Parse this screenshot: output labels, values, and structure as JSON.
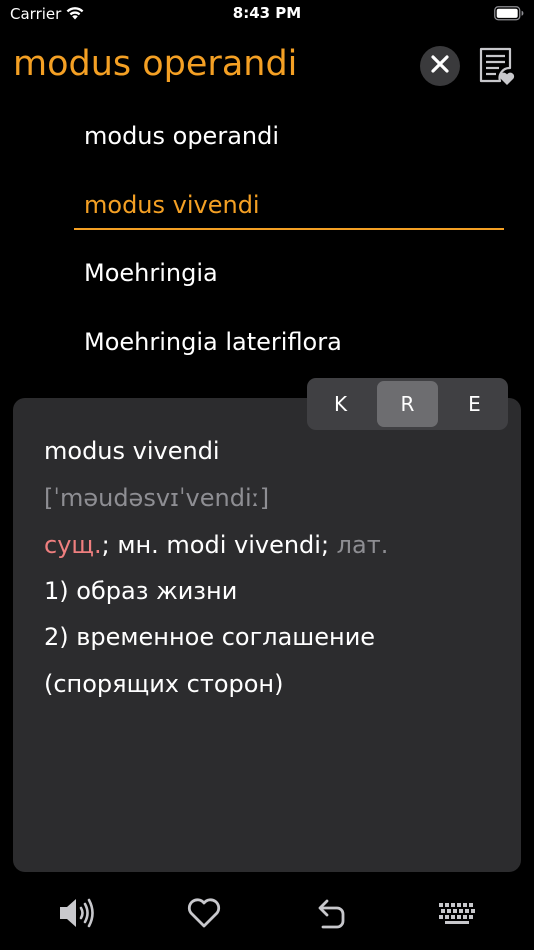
{
  "status_bar": {
    "carrier": "Carrier",
    "time": "8:43 PM"
  },
  "search": {
    "query": "modus operandi"
  },
  "suggestions": [
    {
      "label": "modus operandi",
      "selected": false
    },
    {
      "label": "modus vivendi",
      "selected": true
    },
    {
      "label": "Moehringia",
      "selected": false
    },
    {
      "label": "Moehringia lateriflora",
      "selected": false
    }
  ],
  "segments": [
    {
      "label": "K",
      "active": false
    },
    {
      "label": "R",
      "active": true
    },
    {
      "label": "E",
      "active": false
    }
  ],
  "definition": {
    "headword": "modus vivendi",
    "transcription": "[ˈməudəsvɪˈvendiː]",
    "pos": "сущ.",
    "grammar": "; мн. modi vivendi; ",
    "lang_label": "лат.",
    "sense_1": "1) образ жизни",
    "sense_2_line1": "2) временное соглашение",
    "sense_2_line2": "(спорящих сторон)"
  },
  "colors": {
    "accent": "#f4a024",
    "panel": "#2c2c2e",
    "pos": "#ef7f7f",
    "muted": "#8e8e93"
  },
  "toolbar": {
    "icons": [
      "speaker-icon",
      "heart-icon",
      "undo-icon",
      "keyboard-icon"
    ]
  }
}
